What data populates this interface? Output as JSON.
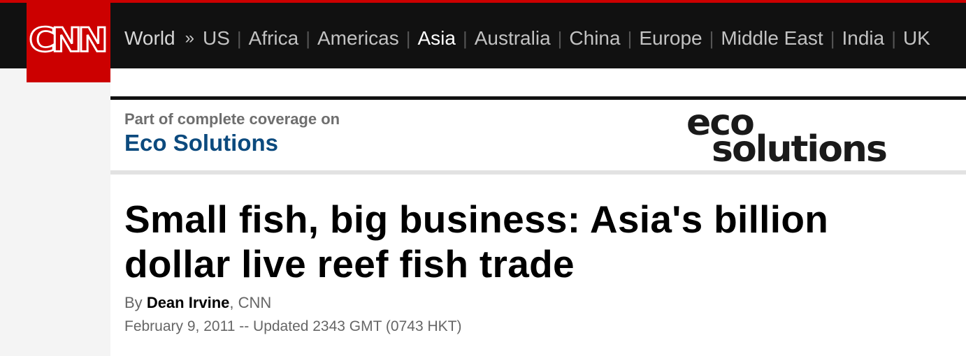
{
  "brand": {
    "logo_text": "CNN",
    "accent_color": "#cc0000"
  },
  "nav": {
    "section": "World",
    "separator": "»",
    "items": [
      {
        "label": "US",
        "active": false
      },
      {
        "label": "Africa",
        "active": false
      },
      {
        "label": "Americas",
        "active": false
      },
      {
        "label": "Asia",
        "active": true
      },
      {
        "label": "Australia",
        "active": false
      },
      {
        "label": "China",
        "active": false
      },
      {
        "label": "Europe",
        "active": false
      },
      {
        "label": "Middle East",
        "active": false
      },
      {
        "label": "India",
        "active": false
      },
      {
        "label": "UK",
        "active": false
      }
    ]
  },
  "coverage": {
    "prefix": "Part of complete coverage on",
    "link_label": "Eco Solutions",
    "link_color": "#0c4a7e",
    "logo_top": "eco",
    "logo_bottom": "solutions"
  },
  "article": {
    "headline": "Small fish, big business: Asia's billion dollar live reef fish trade",
    "byline_prefix": "By",
    "author": "Dean Irvine",
    "outlet": ", CNN",
    "date": "February 9, 2011 -- Updated 2343 GMT (0743 HKT)"
  }
}
